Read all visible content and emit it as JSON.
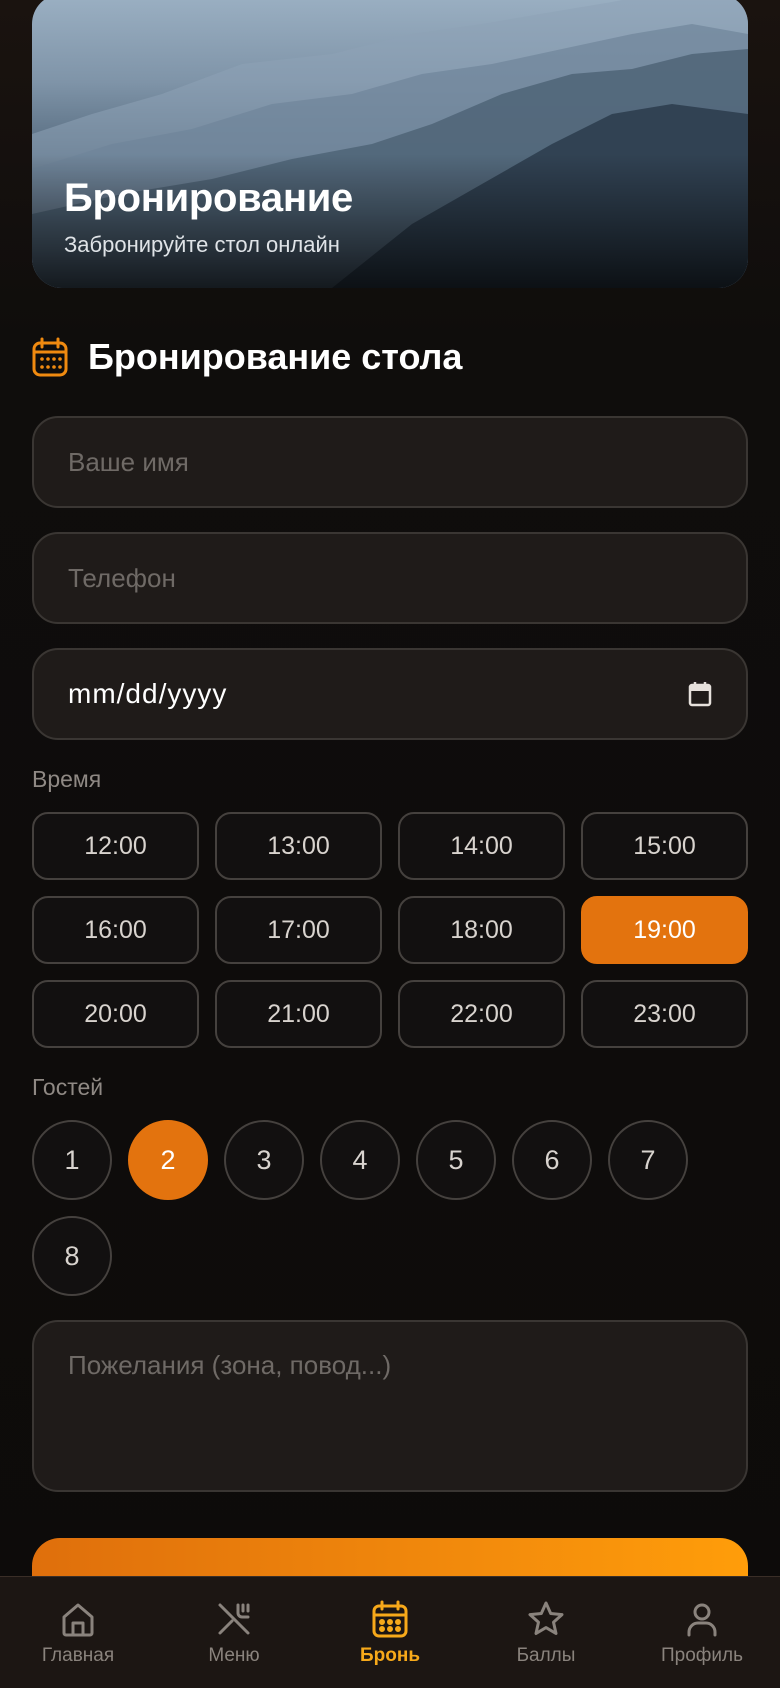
{
  "hero": {
    "title": "Бронирование",
    "subtitle": "Забронируйте стол онлайн"
  },
  "form": {
    "section_icon": "calendar-icon",
    "section_title": "Бронирование стола",
    "name_placeholder": "Ваше имя",
    "phone_placeholder": "Телефон",
    "date_value": "mm/dd/yyyy",
    "time_label": "Время",
    "times": [
      "12:00",
      "13:00",
      "14:00",
      "15:00",
      "16:00",
      "17:00",
      "18:00",
      "19:00",
      "20:00",
      "21:00",
      "22:00",
      "23:00"
    ],
    "selected_time": "19:00",
    "guests_label": "Гостей",
    "guests": [
      "1",
      "2",
      "3",
      "4",
      "5",
      "6",
      "7",
      "8"
    ],
    "selected_guests": "2",
    "wishes_placeholder": "Пожелания (зона, повод...)"
  },
  "nav": {
    "items": [
      {
        "label": "Главная",
        "icon": "home-icon",
        "active": false
      },
      {
        "label": "Меню",
        "icon": "utensils-icon",
        "active": false
      },
      {
        "label": "Бронь",
        "icon": "calendar-icon",
        "active": true
      },
      {
        "label": "Баллы",
        "icon": "star-icon",
        "active": false
      },
      {
        "label": "Профиль",
        "icon": "user-icon",
        "active": false
      }
    ]
  },
  "colors": {
    "accent": "#e3730e",
    "nav_active": "#f7a91a",
    "background": "#0e0c0b"
  }
}
